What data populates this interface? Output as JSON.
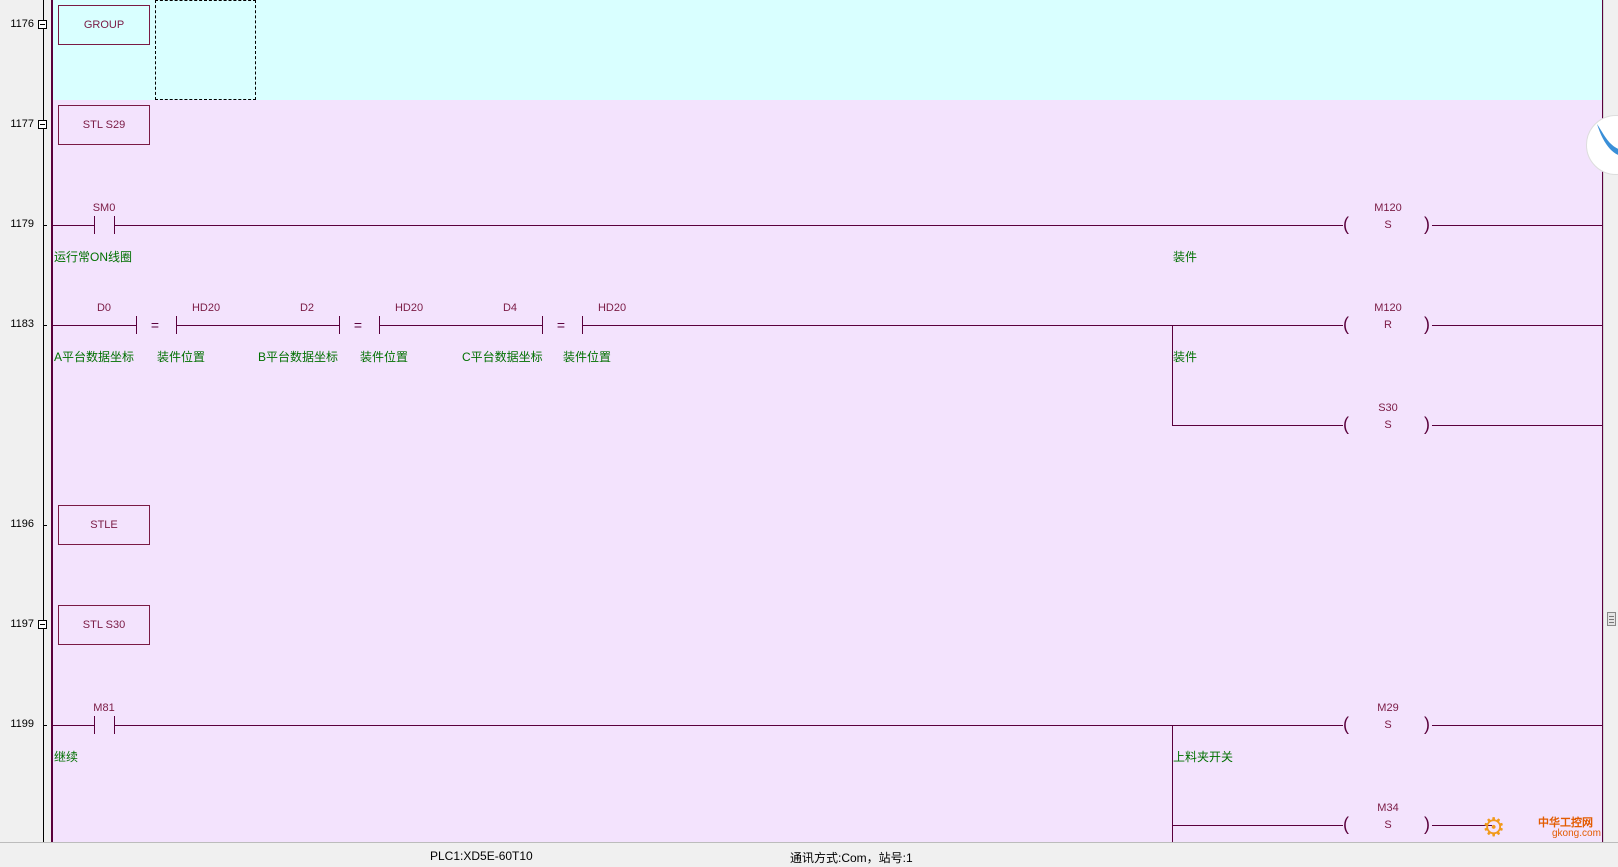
{
  "rungs": [
    {
      "row": "1176",
      "instr": "GROUP"
    },
    {
      "row": "1177",
      "instr": "STL S29"
    },
    {
      "row": "1179",
      "contact": "SM0",
      "contact_comment": "运行常ON线圈",
      "coil": "M120",
      "coil_op": "S",
      "coil_comment": "装件"
    },
    {
      "row": "1183",
      "compares": [
        {
          "a": "D0",
          "b": "HD20",
          "a_comment": "A平台数据坐标",
          "b_comment": "装件位置",
          "op": "="
        },
        {
          "a": "D2",
          "b": "HD20",
          "a_comment": "B平台数据坐标",
          "b_comment": "装件位置",
          "op": "="
        },
        {
          "a": "D4",
          "b": "HD20",
          "a_comment": "C平台数据坐标",
          "b_comment": "装件位置",
          "op": "="
        }
      ],
      "coil1": "M120",
      "coil1_op": "R",
      "coil1_comment": "装件",
      "coil2": "S30",
      "coil2_op": "S"
    },
    {
      "row": "1196",
      "instr": "STLE"
    },
    {
      "row": "1197",
      "instr": "STL S30"
    },
    {
      "row": "1199",
      "contact": "M81",
      "contact_comment": "继续",
      "coil1": "M29",
      "coil1_op": "S",
      "coil1_comment": "上料夹开关",
      "coil2": "M34",
      "coil2_op": "S"
    }
  ],
  "statusbar": {
    "plc": "PLC1:XD5E-60T10",
    "comm": "通讯方式:Com，站号:1"
  },
  "watermark": {
    "name": "中华工控网",
    "url": "gkong.com"
  },
  "colors": {
    "group_band": "#d9ffff",
    "main_band": "#f3e3fd",
    "wire": "#5a003c",
    "comment": "#007000"
  }
}
